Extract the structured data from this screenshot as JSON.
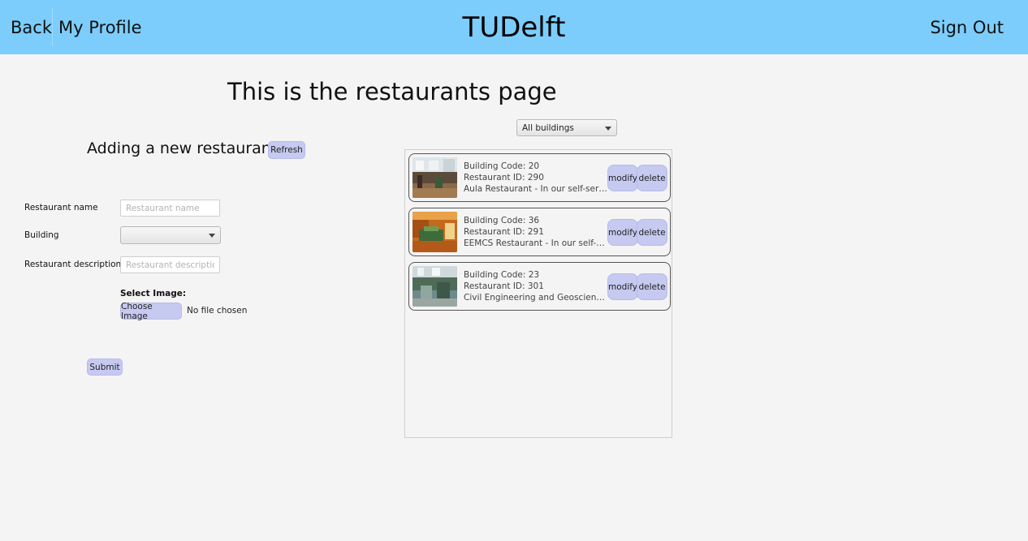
{
  "header": {
    "back_label": "Back",
    "profile_label": "My Profile",
    "brand": "TUDelft",
    "signout_label": "Sign Out"
  },
  "page": {
    "title": "This is the restaurants page",
    "section_title": "Adding a new restaurant",
    "refresh_label": "Refresh"
  },
  "form": {
    "name_label": "Restaurant name",
    "name_placeholder": "Restaurant name",
    "name_value": "",
    "building_label": "Building",
    "building_value": "",
    "description_label": "Restaurant description",
    "description_placeholder": "Restaurant description",
    "description_value": "",
    "select_image_label": "Select Image:",
    "choose_image_label": "Choose Image",
    "no_file_text": "No file chosen",
    "submit_label": "Submit"
  },
  "filter": {
    "selected": "All buildings"
  },
  "restaurants": [
    {
      "building_code": "Building Code: 20",
      "restaurant_id": "Restaurant ID: 290",
      "description": "Aula Restaurant - In our self-service re...",
      "modify_label": "modify",
      "delete_label": "delete"
    },
    {
      "building_code": "Building Code: 36",
      "restaurant_id": "Restaurant ID: 291",
      "description": "EEMCS Restaurant - In our self-service ...",
      "modify_label": "modify",
      "delete_label": "delete"
    },
    {
      "building_code": "Building Code: 23",
      "restaurant_id": "Restaurant ID: 301",
      "description": "Civil Engineering and Geosciences – S...",
      "modify_label": "modify",
      "delete_label": "delete"
    }
  ],
  "colors": {
    "header_bg": "#7ccdfb",
    "button_bg": "#c6c9f0",
    "page_bg": "#f4f4f4"
  }
}
